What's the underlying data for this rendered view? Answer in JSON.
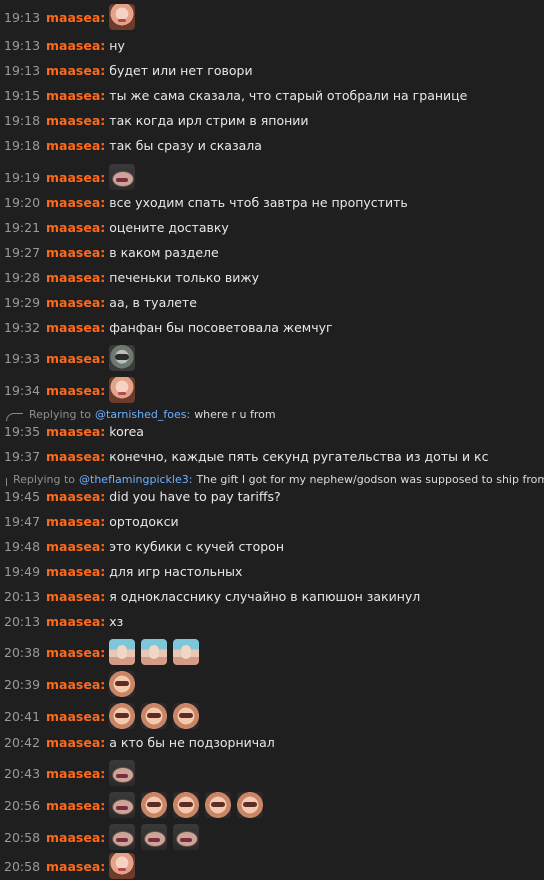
{
  "user": "maasea",
  "colon": ":",
  "replying_prefix": "Replying to",
  "messages": [
    {
      "time": "19:13",
      "type": "emote",
      "emotes": [
        "face"
      ]
    },
    {
      "time": "19:13",
      "text": "ну"
    },
    {
      "time": "19:13",
      "text": "будет или нет говори"
    },
    {
      "time": "19:15",
      "text": "ты же сама сказала, что старый отобрали на границе"
    },
    {
      "time": "19:18",
      "text": "так когда ирл стрим в японии"
    },
    {
      "time": "19:18",
      "text": "так бы сразу и сказала"
    },
    {
      "time": "19:19",
      "type": "emote",
      "emotes": [
        "frog"
      ]
    },
    {
      "time": "19:20",
      "text": "все уходим спать чтоб завтра не пропустить"
    },
    {
      "time": "19:21",
      "text": "оцените доставку"
    },
    {
      "time": "19:27",
      "text": "в каком разделе"
    },
    {
      "time": "19:28",
      "text": "печеньки только вижу"
    },
    {
      "time": "19:29",
      "text": "аа, в туалете"
    },
    {
      "time": "19:32",
      "text": "фанфан бы посоветовала жемчуг"
    },
    {
      "time": "19:33",
      "type": "emote",
      "emotes": [
        "alien"
      ]
    },
    {
      "time": "19:34",
      "type": "emote",
      "emotes": [
        "face"
      ]
    },
    {
      "type": "reply",
      "mention": "@tarnished_foes:",
      "text": "where r u from"
    },
    {
      "time": "19:35",
      "text": "korea"
    },
    {
      "time": "19:37",
      "text": "конечно, каждые пять секунд ругательства из доты и кс"
    },
    {
      "type": "reply",
      "mention": "@theflamingpickle3:",
      "text": "The gift I got for my nephew/godson was supposed to ship from l..."
    },
    {
      "time": "19:45",
      "text": "did you have to pay tariffs?"
    },
    {
      "time": "19:47",
      "text": "ортодокси"
    },
    {
      "time": "19:48",
      "text": "это кубики с кучей сторон"
    },
    {
      "time": "19:49",
      "text": "для игр настольных"
    },
    {
      "time": "20:13",
      "text": "я однокласснику случайно в капюшон закинул"
    },
    {
      "time": "20:13",
      "text": "хз"
    },
    {
      "time": "20:38",
      "type": "emote",
      "emotes": [
        "portrait",
        "portrait",
        "portrait"
      ]
    },
    {
      "time": "20:39",
      "type": "emote",
      "emotes": [
        "hands"
      ]
    },
    {
      "time": "20:41",
      "type": "emote",
      "emotes": [
        "hands",
        "hands",
        "hands"
      ]
    },
    {
      "time": "20:42",
      "text": "а кто бы не подзорничал"
    },
    {
      "time": "20:43",
      "type": "emote",
      "emotes": [
        "frog"
      ]
    },
    {
      "time": "20:56",
      "type": "emote",
      "emotes": [
        "frog",
        "hands",
        "hands",
        "hands",
        "hands"
      ]
    },
    {
      "time": "20:58",
      "type": "emote",
      "emotes": [
        "frog",
        "frog",
        "frog"
      ]
    },
    {
      "time": "20:58",
      "type": "emote",
      "emotes": [
        "face"
      ]
    }
  ]
}
